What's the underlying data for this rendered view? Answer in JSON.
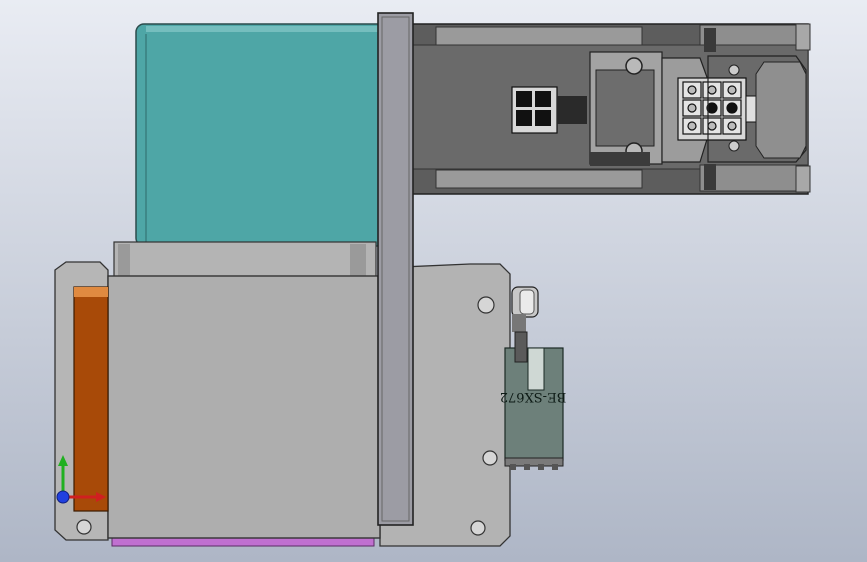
{
  "viewport": {
    "background_top": "#e9ecf3",
    "background_bottom": "#aeb6c6"
  },
  "parts": {
    "teal_body_color": "#4ea6a6",
    "orange_plate_color": "#a84a08",
    "purple_strip_color": "#c070d0",
    "steel_color": "#aeaeae",
    "dark_steel_color": "#5d5d5d",
    "connector_color": "#6d807a"
  },
  "connector_label": "BE-SX672",
  "triad": {
    "x_color": "#d02020",
    "y_color": "#20b020",
    "z_color": "#2040e0"
  }
}
